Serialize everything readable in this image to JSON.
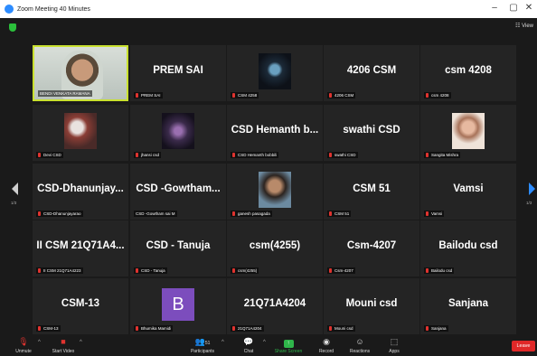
{
  "window": {
    "title": "Zoom Meeting 40 Minutes",
    "controls": [
      "–",
      "▢",
      "✕"
    ]
  },
  "top": {
    "view_label": "☷ View"
  },
  "gallery": {
    "page_indicator_left": "1/3",
    "page_indicator_right": "1/3",
    "tiles": [
      {
        "kind": "video",
        "name": "",
        "label": "BENDI VENKATA RAMANA",
        "active": true
      },
      {
        "kind": "name",
        "name": "PREM SAI",
        "label": "PREM SAI"
      },
      {
        "kind": "video",
        "name": "",
        "label": "CSM 4258"
      },
      {
        "kind": "name",
        "name": "4206 CSM",
        "label": "4206 CSM"
      },
      {
        "kind": "name",
        "name": "csm 4208",
        "label": "csm 4208"
      },
      {
        "kind": "video",
        "name": "",
        "label": "Devi CSD"
      },
      {
        "kind": "video",
        "name": "",
        "label": "jhansi csd"
      },
      {
        "kind": "name",
        "name": "CSD Hemanth b...",
        "label": "CSD Hemanth bobbili"
      },
      {
        "kind": "name",
        "name": "swathi CSD",
        "label": "swathi CSD"
      },
      {
        "kind": "video",
        "name": "",
        "label": "Sangita Mishra"
      },
      {
        "kind": "name",
        "name": "CSD-Dhanunjay...",
        "label": "CSD-Dhanunjayarao"
      },
      {
        "kind": "name",
        "name": "CSD -Gowtham...",
        "label": "CSD -Gowtham sai M"
      },
      {
        "kind": "video",
        "name": "",
        "label": "ganesh pasagada"
      },
      {
        "kind": "name",
        "name": "CSM 51",
        "label": "CSM 51"
      },
      {
        "kind": "name",
        "name": "Vamsi",
        "label": "Vamsi"
      },
      {
        "kind": "name",
        "name": "II CSM 21Q71A4...",
        "label": "II CSM 21Q71A4223"
      },
      {
        "kind": "name",
        "name": "CSD - Tanuja",
        "label": "CSD - Tanuja"
      },
      {
        "kind": "name",
        "name": "csm(4255)",
        "label": "csm(4255)"
      },
      {
        "kind": "name",
        "name": "Csm-4207",
        "label": "Csm-4207"
      },
      {
        "kind": "name",
        "name": "Bailodu csd",
        "label": "Bailodu csd"
      },
      {
        "kind": "name",
        "name": "CSM-13",
        "label": "CSM-13"
      },
      {
        "kind": "avatar",
        "name": "B",
        "label": "Bhumika Mamidi"
      },
      {
        "kind": "name",
        "name": "21Q71A4204",
        "label": "21Q71A4204"
      },
      {
        "kind": "name",
        "name": "Mouni csd",
        "label": "Mouni csd"
      },
      {
        "kind": "name",
        "name": "Sanjana",
        "label": "Sanjana"
      }
    ]
  },
  "toolbar": {
    "unmute": "Unmute",
    "start_video": "Start Video",
    "participants": "Participants",
    "participants_count": "51",
    "chat": "Chat",
    "share_screen": "Share Screen",
    "record": "Record",
    "reactions": "Reactions",
    "apps": "Apps",
    "leave": "Leave"
  },
  "colors": {
    "active_speaker_border": "#c9e02f",
    "share_green": "#2fb54a",
    "leave_red": "#e02828",
    "nav_blue": "#2d8cff"
  }
}
